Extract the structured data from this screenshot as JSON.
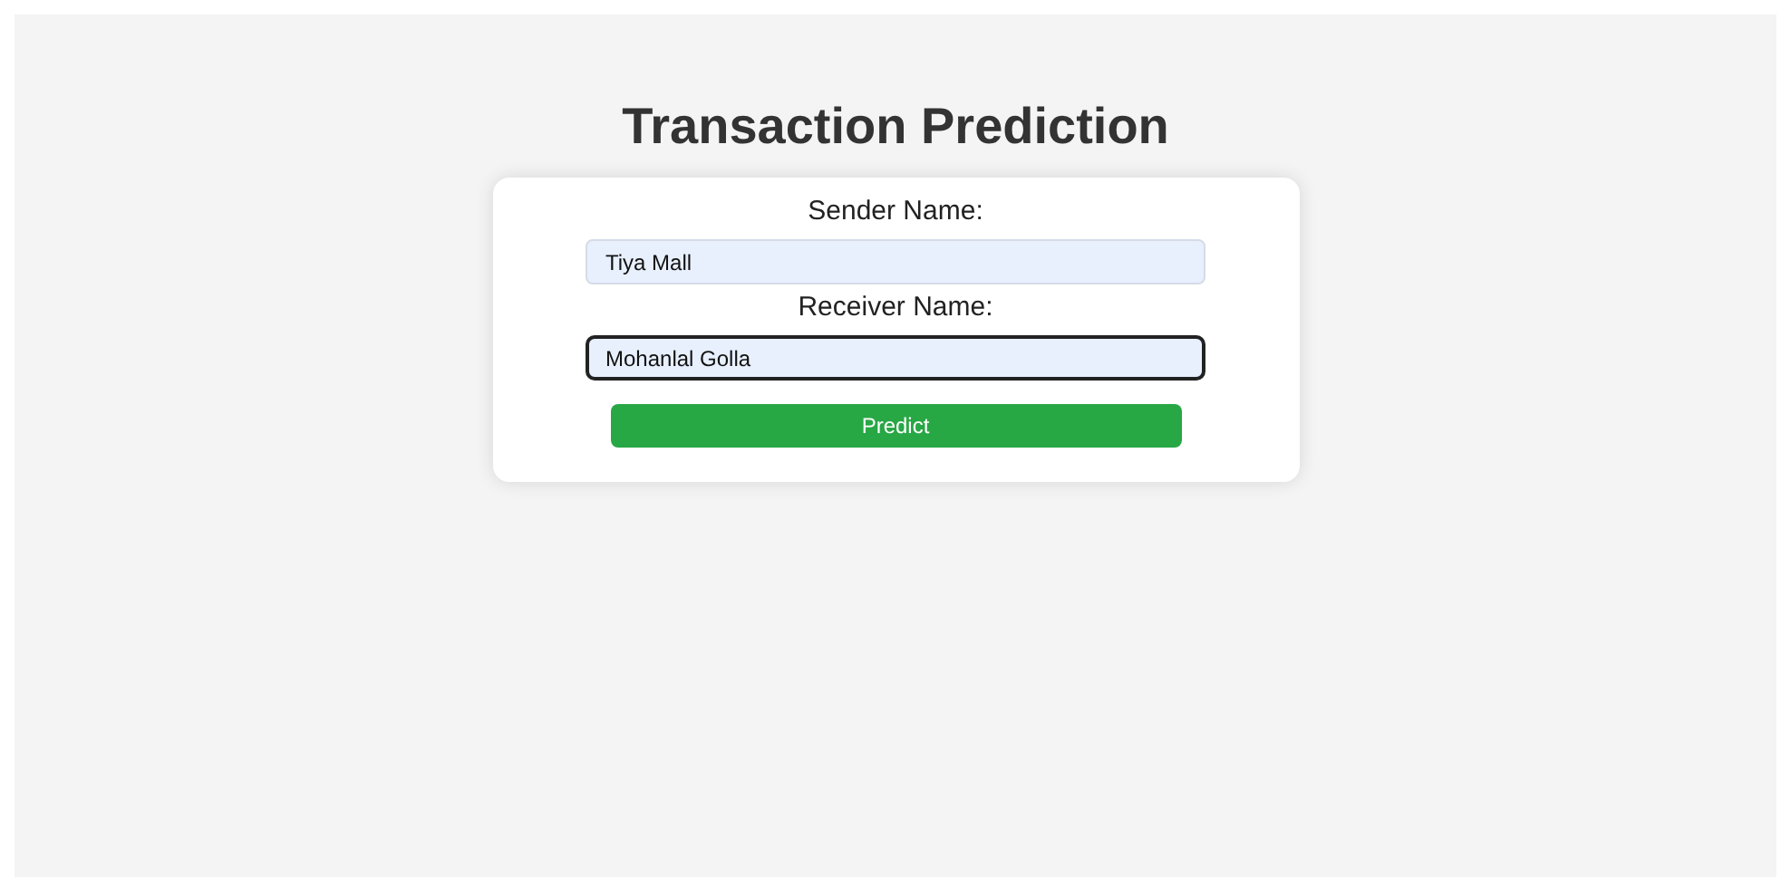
{
  "title": "Transaction Prediction",
  "fields": [
    {
      "label": "Sender Name:",
      "value": "Tiya Mall",
      "focused": false
    },
    {
      "label": "Receiver Name:",
      "value": "Mohanlal Golla",
      "focused": true
    }
  ],
  "button": "Predict"
}
